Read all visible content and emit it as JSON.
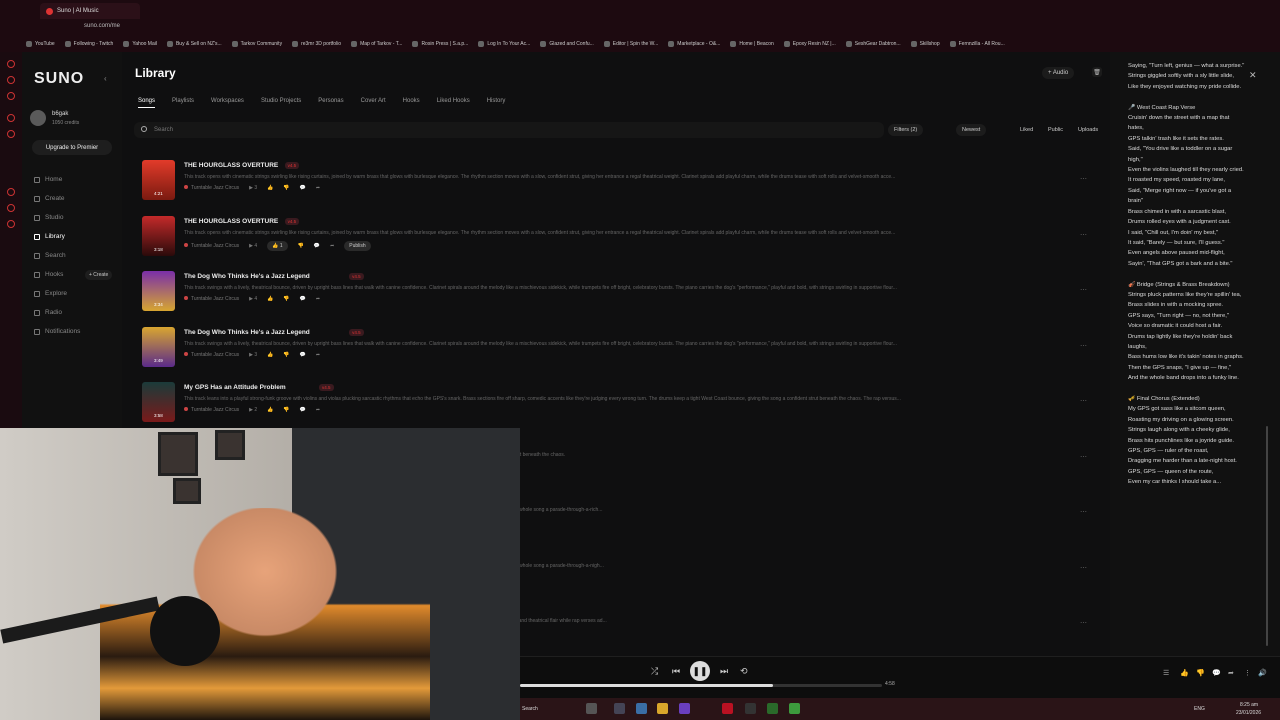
{
  "browser": {
    "tab_title": "Suno | AI Music",
    "url": "suno.com/me",
    "bookmarks": [
      "YouTube",
      "Following - Twitch",
      "Yahoo Mail",
      "Buy & Sell on NZ's...",
      "Tarkov Community",
      "re3mr 3D portfolio",
      "Map of Tarkov - T...",
      "Rosin Press | S.a.p...",
      "Log In To Your Ac...",
      "Glazed and Confu...",
      "Editor | Spin the W...",
      "Marketplace - O&...",
      "Home | Beacon",
      "Epoxy Resin NZ |...",
      "SeshGear Dabtron...",
      "Skillshop",
      "Fernnzilla - All Rou..."
    ]
  },
  "sidebar": {
    "logo": "SUNO",
    "username": "b6gak",
    "credits": "1050 credits",
    "upgrade_label": "Upgrade to Premier",
    "create_pill": "+ Create",
    "nav": [
      {
        "label": "Home"
      },
      {
        "label": "Create"
      },
      {
        "label": "Studio"
      },
      {
        "label": "Library"
      },
      {
        "label": "Search"
      },
      {
        "label": "Hooks"
      },
      {
        "label": "Explore"
      },
      {
        "label": "Radio"
      },
      {
        "label": "Notifications"
      }
    ]
  },
  "main": {
    "title": "Library",
    "tabs": [
      "Songs",
      "Playlists",
      "Workspaces",
      "Studio Projects",
      "Personas",
      "Cover Art",
      "Hooks",
      "Liked Hooks",
      "History"
    ],
    "audio_label": "+ Audio",
    "search_placeholder": "Search",
    "filters": {
      "filters": "Filters (2)",
      "sort": "Newest",
      "liked": "Liked",
      "public": "Public",
      "uploads": "Uploads"
    }
  },
  "songs": [
    {
      "title": "THE HOURGLASS OVERTURE",
      "version": "v4.5",
      "duration": "4:21",
      "artist": "Turntable Jazz Circus",
      "plays": "3",
      "desc": "This track opens with cinematic strings swirling like rising curtains, joined by warm brass that glows with burlesque elegance. The rhythm section moves with a slow, confident strut, giving her entrance a regal theatrical weight. Clarinet spirals add playful charm, while the drums tease with soft rolls and velvet-smooth acce..."
    },
    {
      "title": "THE HOURGLASS OVERTURE",
      "version": "v4.5",
      "duration": "3:18",
      "artist": "Turntable Jazz Circus",
      "plays": "4",
      "likes": "1",
      "publish": "Publish",
      "desc": "This track opens with cinematic strings swirling like rising curtains, joined by warm brass that glows with burlesque elegance. The rhythm section moves with a slow, confident strut, giving her entrance a regal theatrical weight. Clarinet spirals add playful charm, while the drums tease with soft rolls and velvet-smooth acce..."
    },
    {
      "title": "The Dog Who Thinks He's a Jazz Legend",
      "version": "v4.5",
      "duration": "3:34",
      "artist": "Turntable Jazz Circus",
      "plays": "4",
      "desc": "This track swings with a lively, theatrical bounce, driven by upright bass lines that walk with canine confidence. Clarinet spirals around the melody like a mischievous sidekick, while trumpets fire off bright, celebratory bursts. The piano carries the dog's \"performance,\" playful and bold, with strings swirling in supportive flour..."
    },
    {
      "title": "The Dog Who Thinks He's a Jazz Legend",
      "version": "v4.5",
      "duration": "3:49",
      "artist": "Turntable Jazz Circus",
      "plays": "3",
      "desc": "This track swings with a lively, theatrical bounce, driven by upright bass lines that walk with canine confidence. Clarinet spirals around the melody like a mischievous sidekick, while trumpets fire off bright, celebratory bursts. The piano carries the dog's \"performance,\" playful and bold, with strings swirling in supportive flour..."
    },
    {
      "title": "My GPS Has an Attitude Problem",
      "version": "v4.5",
      "duration": "3:58",
      "artist": "Turntable Jazz Circus",
      "plays": "2",
      "desc": "This track leans into a playful strong-funk groove with violins and violas plucking sarcastic rhythms that echo the GPS's snark. Brass sections fire off sharp, comedic accents like they're judging every wrong turn. The drums keep a tight West Coast bounce, giving the song a confident strut beneath the chaos. The rap versus..."
    },
    {
      "title": "",
      "version": "",
      "duration": "",
      "artist": "",
      "plays": "",
      "desc": "...tions fire off sharp, comedic accents like they're judging every wrong turn. The drums keep a tight West Coast bounce, giving the song a confident strut beneath the chaos."
    },
    {
      "title": "",
      "version": "",
      "duration": "",
      "artist": "",
      "plays": "",
      "desc": "...playful accents while violins slide in with cheeky glissandos that tease the rhythm. The drums hit with a confident, dance-floor-ready stomp, giving the whole song a parade-through-a-rich..."
    },
    {
      "title": "",
      "version": "",
      "duration": "",
      "artist": "",
      "plays": "",
      "desc": "...playful accents while violins slide in with cheeky glissandos that tease the rhythm. The drums hit with a confident, dance-floor-ready stomp, giving the whole song a parade-through-a-nigh..."
    },
    {
      "title": "",
      "version": "",
      "duration": "",
      "artist": "",
      "plays": "",
      "desc": "...confident built on swung drums, crisp snares, rubbery basslines, and punchy horn stabs that accentuate comedic timing. Vocals mix swagger, humor, and theatrical flair while rap verses ad..."
    }
  ],
  "lyrics": {
    "text": "Saying, \"Turn left, genius — what a surprise.\"\nStrings giggled softly with a sly little slide,\nLike they enjoyed watching my pride collide.\n\n🎤 West Coast Rap Verse\nCruisin' down the street with a map that hates,\nGPS talkin' trash like it sets the rates.\nSaid, \"You drive like a toddler on a sugar high,\"\nEven the violins laughed till they nearly cried.\nIt roasted my speed, roasted my lane,\nSaid, \"Merge right now — if you've got a brain\"\nBrass chimed in with a sarcastic blast,\nDrums rolled eyes with a judgment cast.\nI said, \"Chill out, I'm doin' my best,\"\nIt said, \"Barely — but sure, I'll guess.\"\nEven angels above paused mid-flight,\nSayin', \"That GPS got a bark and a bite.\"\n\n🎻 Bridge (Strings & Brass Breakdown)\nStrings pluck patterns like they're spillin' tea,\nBrass slides in with a mocking spree.\nGPS says, \"Turn right — no, not there,\"\nVoice so dramatic it could host a fair.\nDrums tap lightly like they're holdin' back laughs,\nBass hums low like it's takin' notes in graphs.\nThen the GPS snaps, \"I give up — fine,\"\nAnd the whole band drops into a funky line.\n\n🎺 Final Chorus (Extended)\nMy GPS got sass like a sitcom queen,\nRoasting my driving on a glowing screen.\nStrings laugh along with a cheeky glide,\nBrass hits punchlines like a joyride guide.\nGPS, GPS — ruler of the roast,\nDragging me harder than a late-night host.\nGPS, GPS — queen of the route,\nEven my car thinks I should take a..."
  },
  "player": {
    "total_time": "4:58",
    "progress": 0.7
  },
  "taskbar": {
    "search_label": "Search",
    "lang": "ENG",
    "time": "8:25 am",
    "date": "23/01/2026"
  }
}
